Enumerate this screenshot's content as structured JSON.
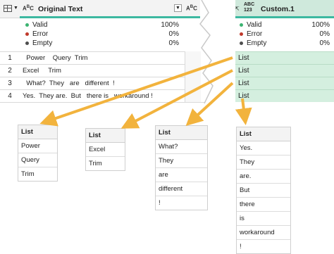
{
  "header": {
    "original_col": "Original Text",
    "original_type": "A B C",
    "custom_col": "Custom.1",
    "custom_type_line1": "ABC",
    "custom_type_line2": "123"
  },
  "stats_left": [
    {
      "label": "Valid",
      "value": "100%"
    },
    {
      "label": "Error",
      "value": "0%"
    },
    {
      "label": "Empty",
      "value": "0%"
    }
  ],
  "stats_right": [
    {
      "label": "Valid",
      "value": "100%"
    },
    {
      "label": "Error",
      "value": "0%"
    },
    {
      "label": "Empty",
      "value": "0%"
    }
  ],
  "rows": [
    {
      "n": "1",
      "text": "  Power    Query  Trim",
      "list": "List"
    },
    {
      "n": "2",
      "text": "Excel     Trim",
      "list": "List"
    },
    {
      "n": "3",
      "text": "  What?  They   are   different  !",
      "list": "List"
    },
    {
      "n": "4",
      "text": "Yes.  They are.  But   there is   workaround !",
      "list": "List"
    }
  ],
  "lists": [
    {
      "header": "List",
      "items": [
        "Power",
        "Query",
        "Trim"
      ]
    },
    {
      "header": "List",
      "items": [
        "Excel",
        "Trim"
      ]
    },
    {
      "header": "List",
      "items": [
        "What?",
        "They",
        "are",
        "different",
        "!"
      ]
    },
    {
      "header": "List",
      "items": [
        "Yes.",
        "They",
        "are.",
        "But",
        "there",
        "is",
        "workaround",
        "!"
      ]
    }
  ],
  "colors": {
    "valid": "#3cb371",
    "error": "#c0392b",
    "empty": "#4d4d4d",
    "bar": "#3cb8a0",
    "list_bg": "#d4efdf",
    "arrow": "#f2b33d"
  }
}
